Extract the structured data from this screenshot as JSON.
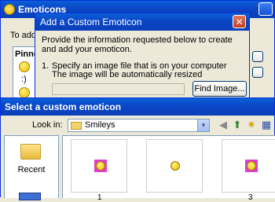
{
  "emoticons_window": {
    "title": "Emoticons",
    "to_add_text": "To add",
    "pinned_header": "Pinne",
    "emoticon_glyph": ":)"
  },
  "dialog": {
    "title": "Add a Custom Emoticon",
    "close_glyph": "✕",
    "intro": "Provide the information requested below to create and add your emoticon.",
    "step_number": "1.",
    "step_line1": "Specify an image file that is on your computer",
    "step_line2": "The image will be automatically resized",
    "find_image_label": "Find Image...",
    "file_path_value": ""
  },
  "file_dialog": {
    "title": "Select a custom emoticon",
    "look_in_label": "Look in:",
    "look_in_value": "Smileys",
    "places": [
      {
        "label": "Recent"
      }
    ],
    "file_labels": [
      "1",
      "",
      "3"
    ]
  }
}
